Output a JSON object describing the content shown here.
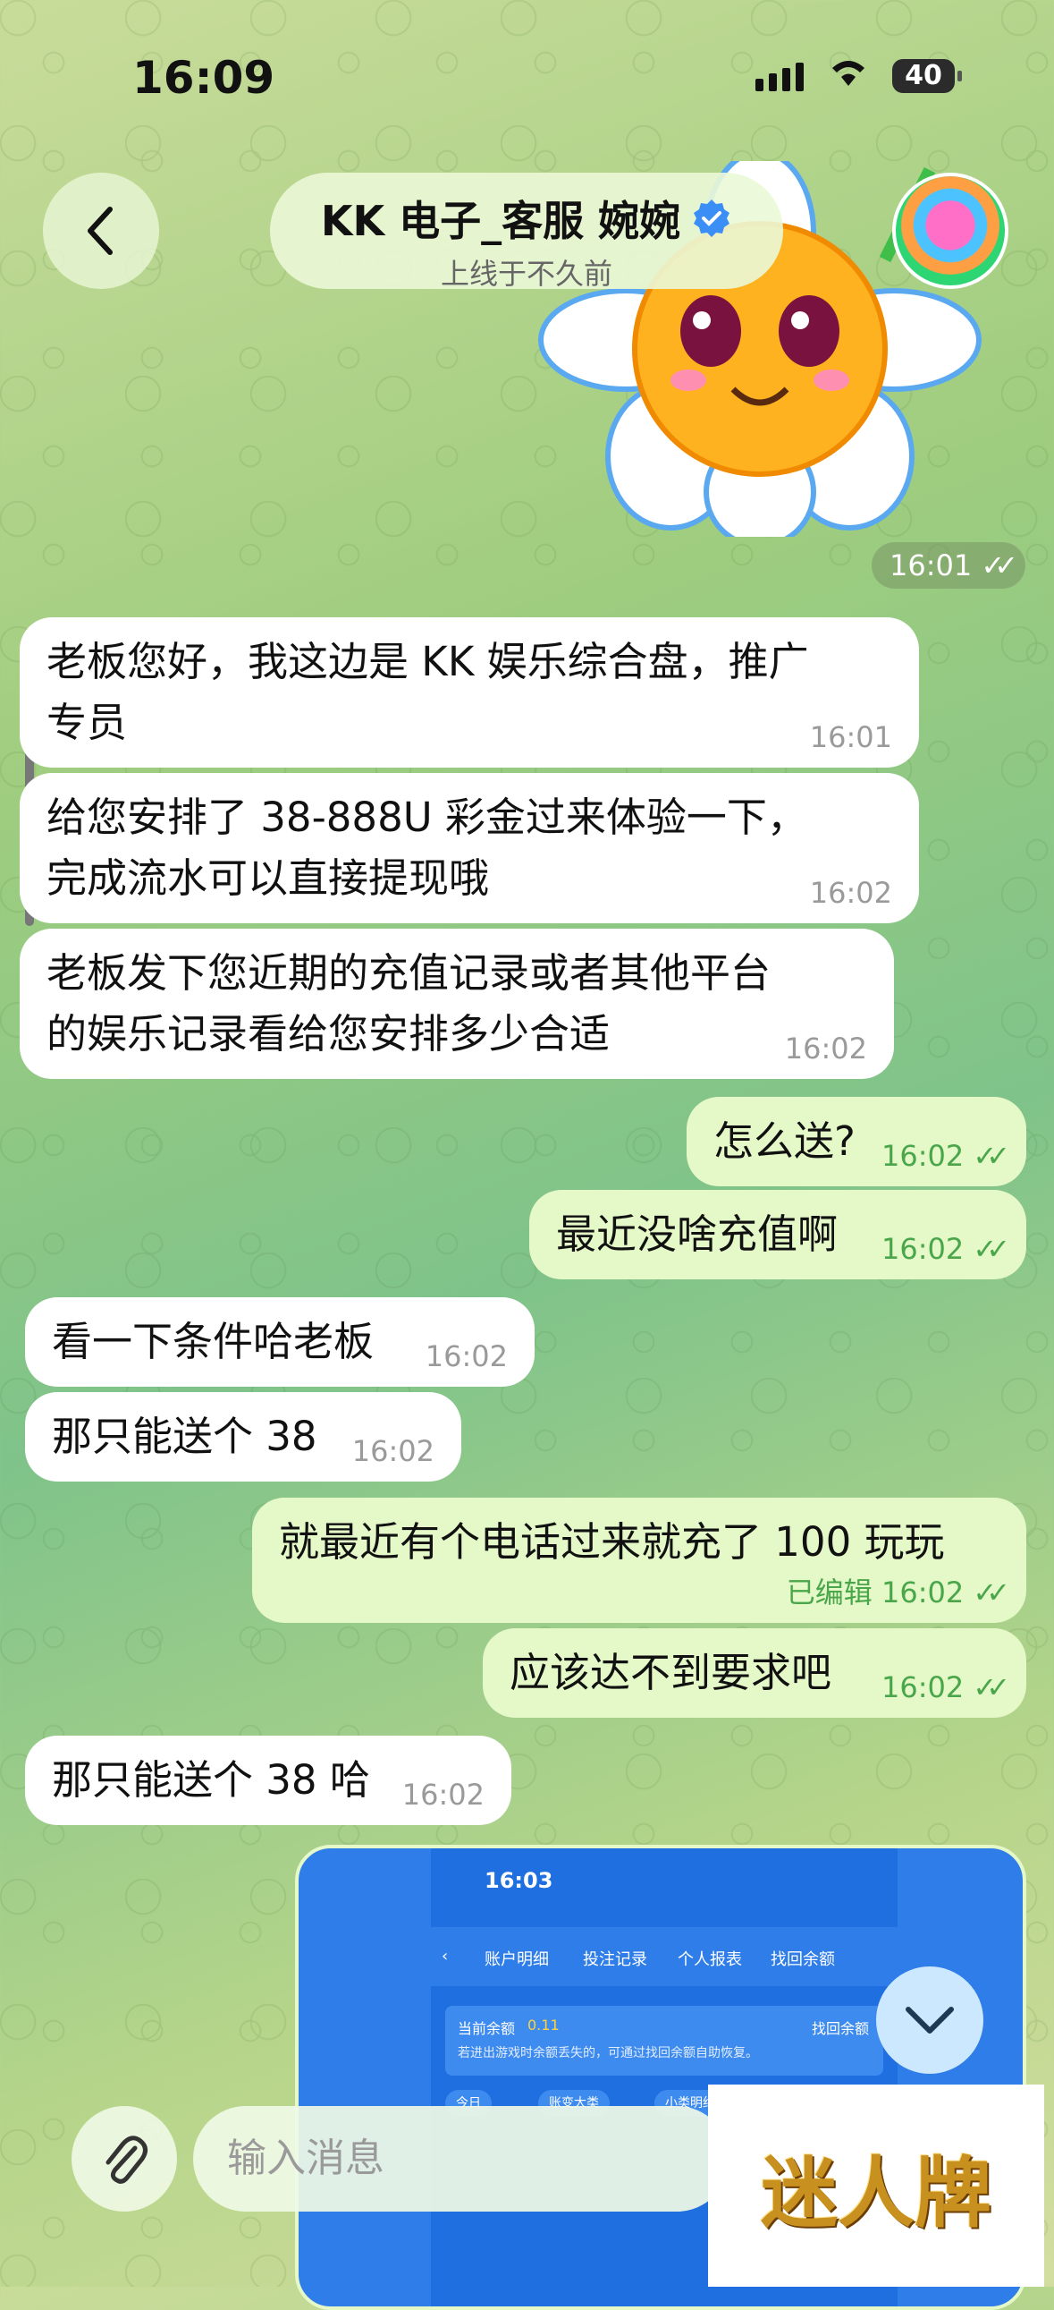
{
  "status_bar": {
    "time": "16:09",
    "battery": "40"
  },
  "header": {
    "title": "KK 电子_客服 婉婉",
    "subtitle": "上线于不久前"
  },
  "sticker": {
    "time": "16:01"
  },
  "messages": [
    {
      "dir": "in",
      "text_line1": "老板您好，我这边是 KK 娱乐综合盘，推广",
      "text_line2": "专员",
      "time": "16:01"
    },
    {
      "dir": "in",
      "text_line1": "给您安排了 38-888U 彩金过来体验一下，",
      "text_line2": "完成流水可以直接提现哦",
      "time": "16:02"
    },
    {
      "dir": "in",
      "text_line1": "老板发下您近期的充值记录或者其他平台",
      "text_line2": "的娱乐记录看给您安排多少合适",
      "time": "16:02"
    },
    {
      "dir": "out",
      "text": "怎么送?",
      "time": "16:02"
    },
    {
      "dir": "out",
      "text": "最近没啥充值啊",
      "time": "16:02"
    },
    {
      "dir": "in",
      "text": "看一下条件哈老板",
      "time": "16:02"
    },
    {
      "dir": "in",
      "text": "那只能送个 38",
      "time": "16:02"
    },
    {
      "dir": "out",
      "text": "就最近有个电话过来就充了 100 玩玩",
      "edited": "已编辑",
      "time": "16:02"
    },
    {
      "dir": "out",
      "text": "应该达不到要求吧",
      "time": "16:02"
    },
    {
      "dir": "in",
      "text": "那只能送个 38 哈",
      "time": "16:02"
    }
  ],
  "image_message": {
    "status_time": "16:03",
    "tabs": [
      "账户明细",
      "投注记录",
      "个人报表",
      "找回余额"
    ],
    "balance_label": "当前余额",
    "balance_value": "0.11",
    "recover_label": "找回余额",
    "hint": "若进出游戏时余额丢失的，可通过找回余额自助恢复。",
    "filters": [
      "今日",
      "账变大类",
      "小类明细"
    ]
  },
  "composer": {
    "placeholder": "输入消息"
  },
  "watermark": "迷人牌",
  "colors": {
    "outgoing_bubble": "#e4f8c8",
    "incoming_bubble": "#ffffff",
    "accent_green": "#4aa64a",
    "verified_blue": "#3a8ef6"
  }
}
